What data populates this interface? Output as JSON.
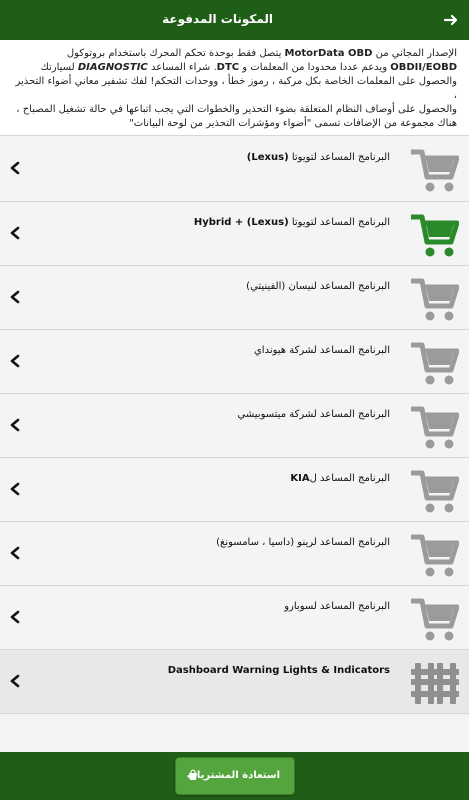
{
  "header": {
    "title": "المكونات المدفوعة"
  },
  "intro": {
    "line1a": "الإصدار المجاني من ",
    "line1b": "MotorData OBD",
    "line1c": " يتصل فقط بوحدة تحكم المحرك باستخدام بروتوكول",
    "line2a": "OBDII/EOBD",
    "line2b": " ويدعم عددا محدودا من المعلمات و ",
    "line2c": "DTC",
    "line2d": ". شراء المساعد ",
    "line2e": "DIAGNOSTIC",
    "line2f": " لسيارتك",
    "line3": "والحصول على المعلمات الخاصة بكل مركبة ، رموز خطأ ، ووحدات التحكم! لفك تشفير معاني أضواء التحذير ،",
    "line4": "والحصول على أوصاف النظام المتعلقة بضوء التحذير والخطوات التي يجب اتباعها في حالة تشغيل المصباح ،",
    "line5": "هناك مجموعة من الإضافات تسمى \"أضواء ومؤشرات التحذير من لوحة البيانات\""
  },
  "items": [
    {
      "title_ar": "البرنامج المساعد لتويوتا",
      "title_latin": "(Lexus)",
      "icon": "cart-icon",
      "purchased": false
    },
    {
      "title_ar": "البرنامج المساعد لتويوتا",
      "title_latin": "(Lexus) + Hybrid",
      "icon": "cart-icon",
      "purchased": true
    },
    {
      "title_ar": "البرنامج المساعد لنيسان (الفينيتي)",
      "title_latin": "",
      "icon": "cart-icon",
      "purchased": false
    },
    {
      "title_ar": "البرنامج المساعد لشركة هيونداي",
      "title_latin": "",
      "icon": "cart-icon",
      "purchased": false
    },
    {
      "title_ar": "البرنامج المساعد لشركة ميتسوبيشي",
      "title_latin": "",
      "icon": "cart-icon",
      "purchased": false
    },
    {
      "title_ar": "البرنامج المساعد ل",
      "title_latin": "KIA",
      "icon": "cart-icon",
      "purchased": false
    },
    {
      "title_ar": "البرنامج المساعد لرينو (داسيا ، سامسونغ)",
      "title_latin": "",
      "icon": "cart-icon",
      "purchased": false
    },
    {
      "title_ar": "البرنامج المساعد لسوبارو",
      "title_latin": "",
      "icon": "cart-icon",
      "purchased": false
    },
    {
      "title_ar": "",
      "title_latin": "Dashboard Warning Lights & Indicators",
      "icon": "warning-lights-icon",
      "purchased": false
    }
  ],
  "footer": {
    "restore_label": "استعادة المشتريات",
    "icon": "shopping-bag-icon"
  },
  "colors": {
    "header_bg": "#1f5e16",
    "cart_gray": "#9b9b9b",
    "cart_green": "#2a8a2a",
    "button_green": "#55a53f"
  }
}
